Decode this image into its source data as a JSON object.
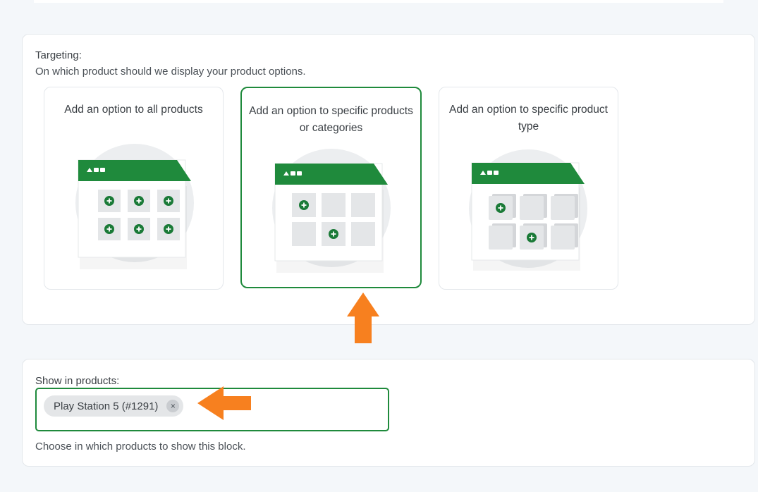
{
  "targeting": {
    "label": "Targeting:",
    "help": "On which product should we display your product options.",
    "options": [
      {
        "title": "Add an option to all products",
        "selected": false
      },
      {
        "title": "Add an option to specific products or categories",
        "selected": true
      },
      {
        "title": "Add an option to specific product type",
        "selected": false
      }
    ]
  },
  "products": {
    "label": "Show in products:",
    "tags": [
      {
        "label": "Play Station 5 (#1291)"
      }
    ],
    "remove_icon": "×",
    "help": "Choose in which products to show this block."
  },
  "colors": {
    "accent": "#1f8a3c",
    "annotation_arrow": "#f7801f"
  },
  "icons": {
    "illustration_header_dots": "window-dots-icon",
    "add": "plus-circle-icon",
    "annotation": "arrow-icon"
  }
}
